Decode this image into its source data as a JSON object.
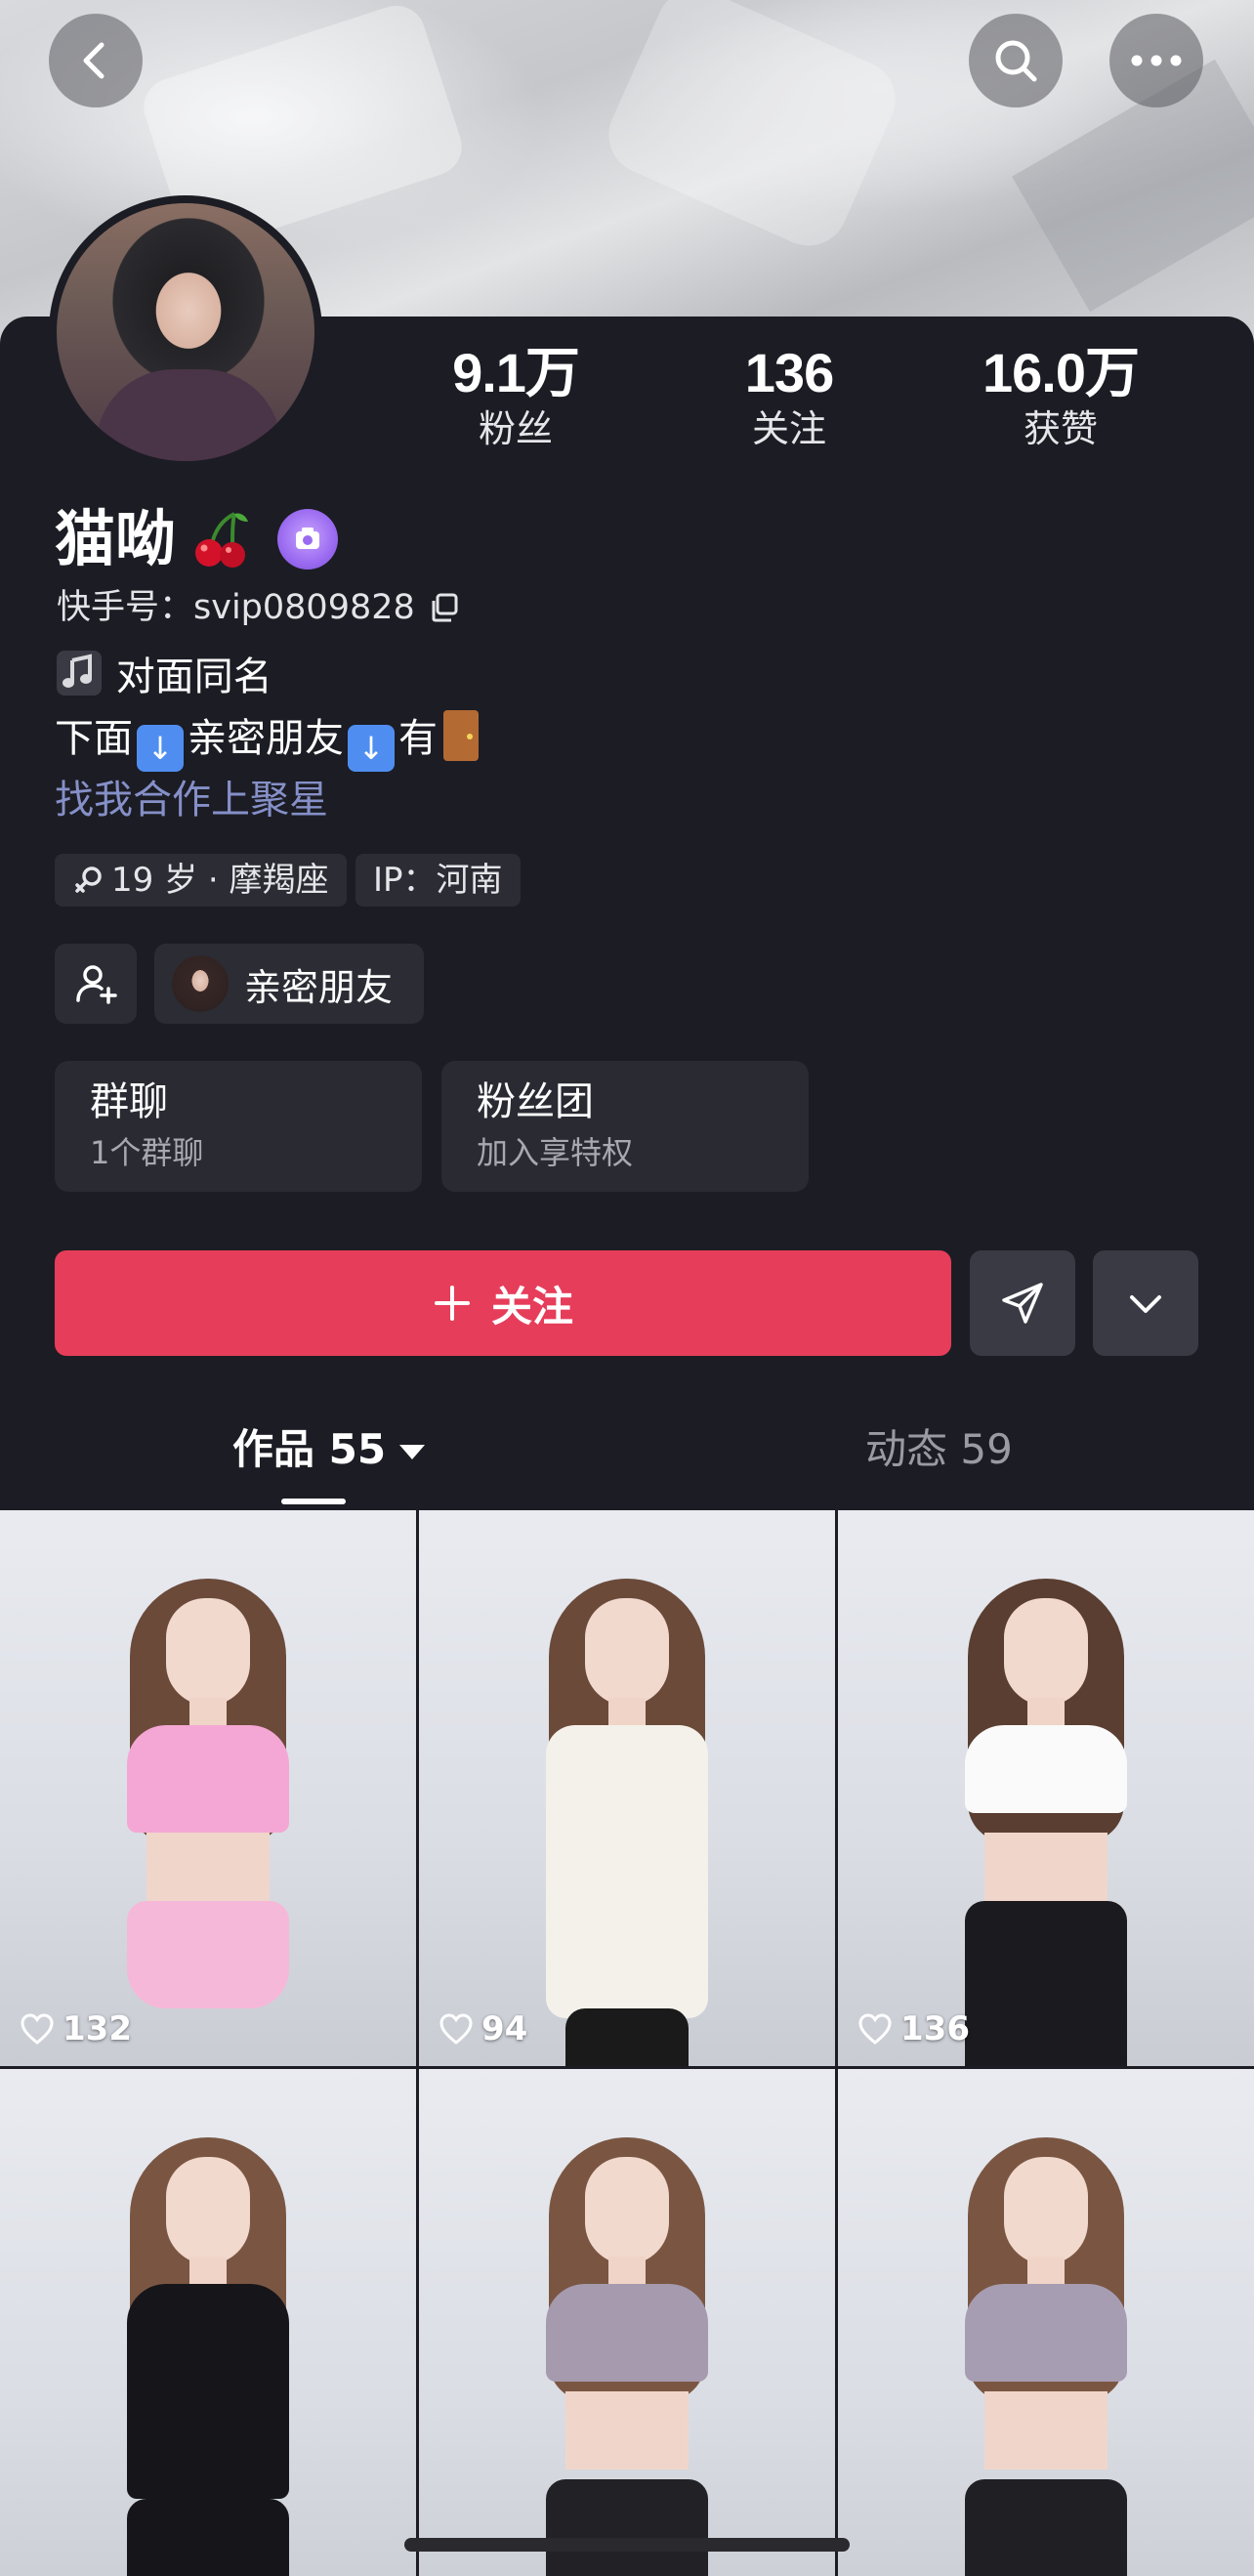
{
  "profile": {
    "name": "猫呦",
    "kuaishou_id": "快手号：svip0809828",
    "bio_line1": "对面同名",
    "bio_line2_a": "下面",
    "bio_line2_b": "亲密朋友",
    "bio_line2_c": "有",
    "bio_link": "找我合作上聚星",
    "tag_age": "19 岁 · 摩羯座",
    "tag_ip": "IP：河南",
    "close_friends_label": "亲密朋友"
  },
  "stats": [
    {
      "value": "9.1万",
      "label": "粉丝"
    },
    {
      "value": "136",
      "label": "关注"
    },
    {
      "value": "16.0万",
      "label": "获赞"
    }
  ],
  "panels": {
    "group_title": "群聊",
    "group_sub": "1个群聊",
    "fan_title": "粉丝团",
    "fan_sub": "加入享特权"
  },
  "actions": {
    "follow_label": "关注"
  },
  "tabs": {
    "works_label": "作品 55",
    "dynamics_label": "动态 59"
  },
  "videos": [
    {
      "likes": "132"
    },
    {
      "likes": "94"
    },
    {
      "likes": "136"
    }
  ],
  "icons": [
    "back-icon",
    "search-icon",
    "more-icon",
    "copy-icon",
    "music-note-icon",
    "arrow-down-emoji-icon",
    "door-emoji-icon",
    "cherry-emoji-icon",
    "verified-badge-icon",
    "female-icon",
    "add-friend-icon",
    "plus-icon",
    "send-icon",
    "chevron-down-icon",
    "heart-icon"
  ],
  "colors": {
    "follow_button": "#e63d5a",
    "background": "#1c1c24",
    "link": "#8590c8"
  }
}
